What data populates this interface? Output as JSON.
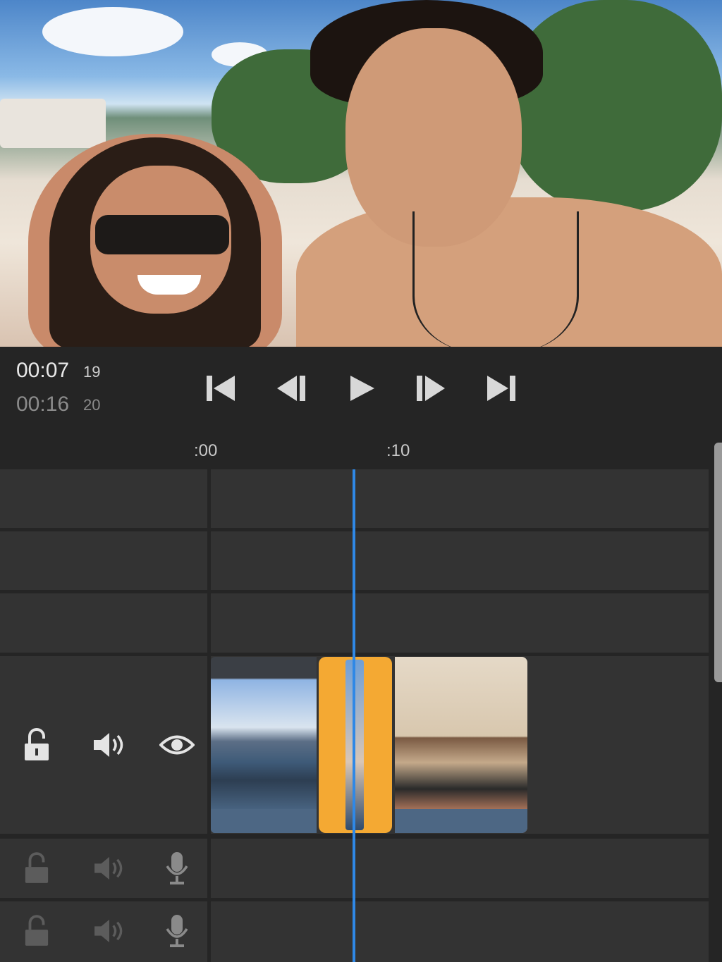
{
  "playback": {
    "current_time": "00:07",
    "current_frame": "19",
    "total_time": "00:16",
    "total_frame": "20"
  },
  "transport": {
    "icons": [
      "skip-to-start-icon",
      "step-back-icon",
      "play-icon",
      "step-forward-icon",
      "skip-to-end-icon"
    ]
  },
  "ruler": {
    "labels": [
      ":00",
      ":10"
    ]
  },
  "tracks": {
    "video_main_icons": [
      "unlock-icon",
      "speaker-icon",
      "eye-icon"
    ],
    "audio_icons": [
      "unlock-icon",
      "speaker-icon",
      "microphone-icon"
    ]
  },
  "colors": {
    "background": "#252525",
    "track": "#333333",
    "playhead": "#2f88e6",
    "selected_clip": "#f4a933",
    "waveform": "#4d6784"
  }
}
